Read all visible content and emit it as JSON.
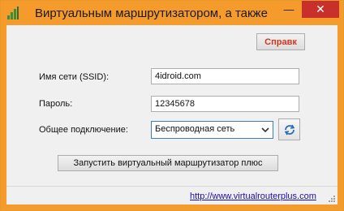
{
  "window": {
    "title": "Виртуальным маршрутизатором, а также",
    "minimize_glyph": "—",
    "close_glyph": "✕",
    "icon": "app-signal-icon"
  },
  "toolbar": {
    "help_label": "Справк"
  },
  "form": {
    "ssid_label": "Имя сети (SSID):",
    "ssid_value": "4idroid.com",
    "password_label": "Пароль:",
    "password_value": "12345678",
    "connection_label": "Общее подключение:",
    "connection_selected": "Беспроводная сеть",
    "refresh_icon": "refresh-icon"
  },
  "actions": {
    "start_label": "Запустить виртуальный маршрутизатор плюс"
  },
  "status": {
    "website": "http://www.virtualrouterplus.com"
  },
  "colors": {
    "title_bar": "#f49b2c",
    "close_button": "#c7302b",
    "help_text": "#d8341a",
    "link": "#1a0dab"
  }
}
